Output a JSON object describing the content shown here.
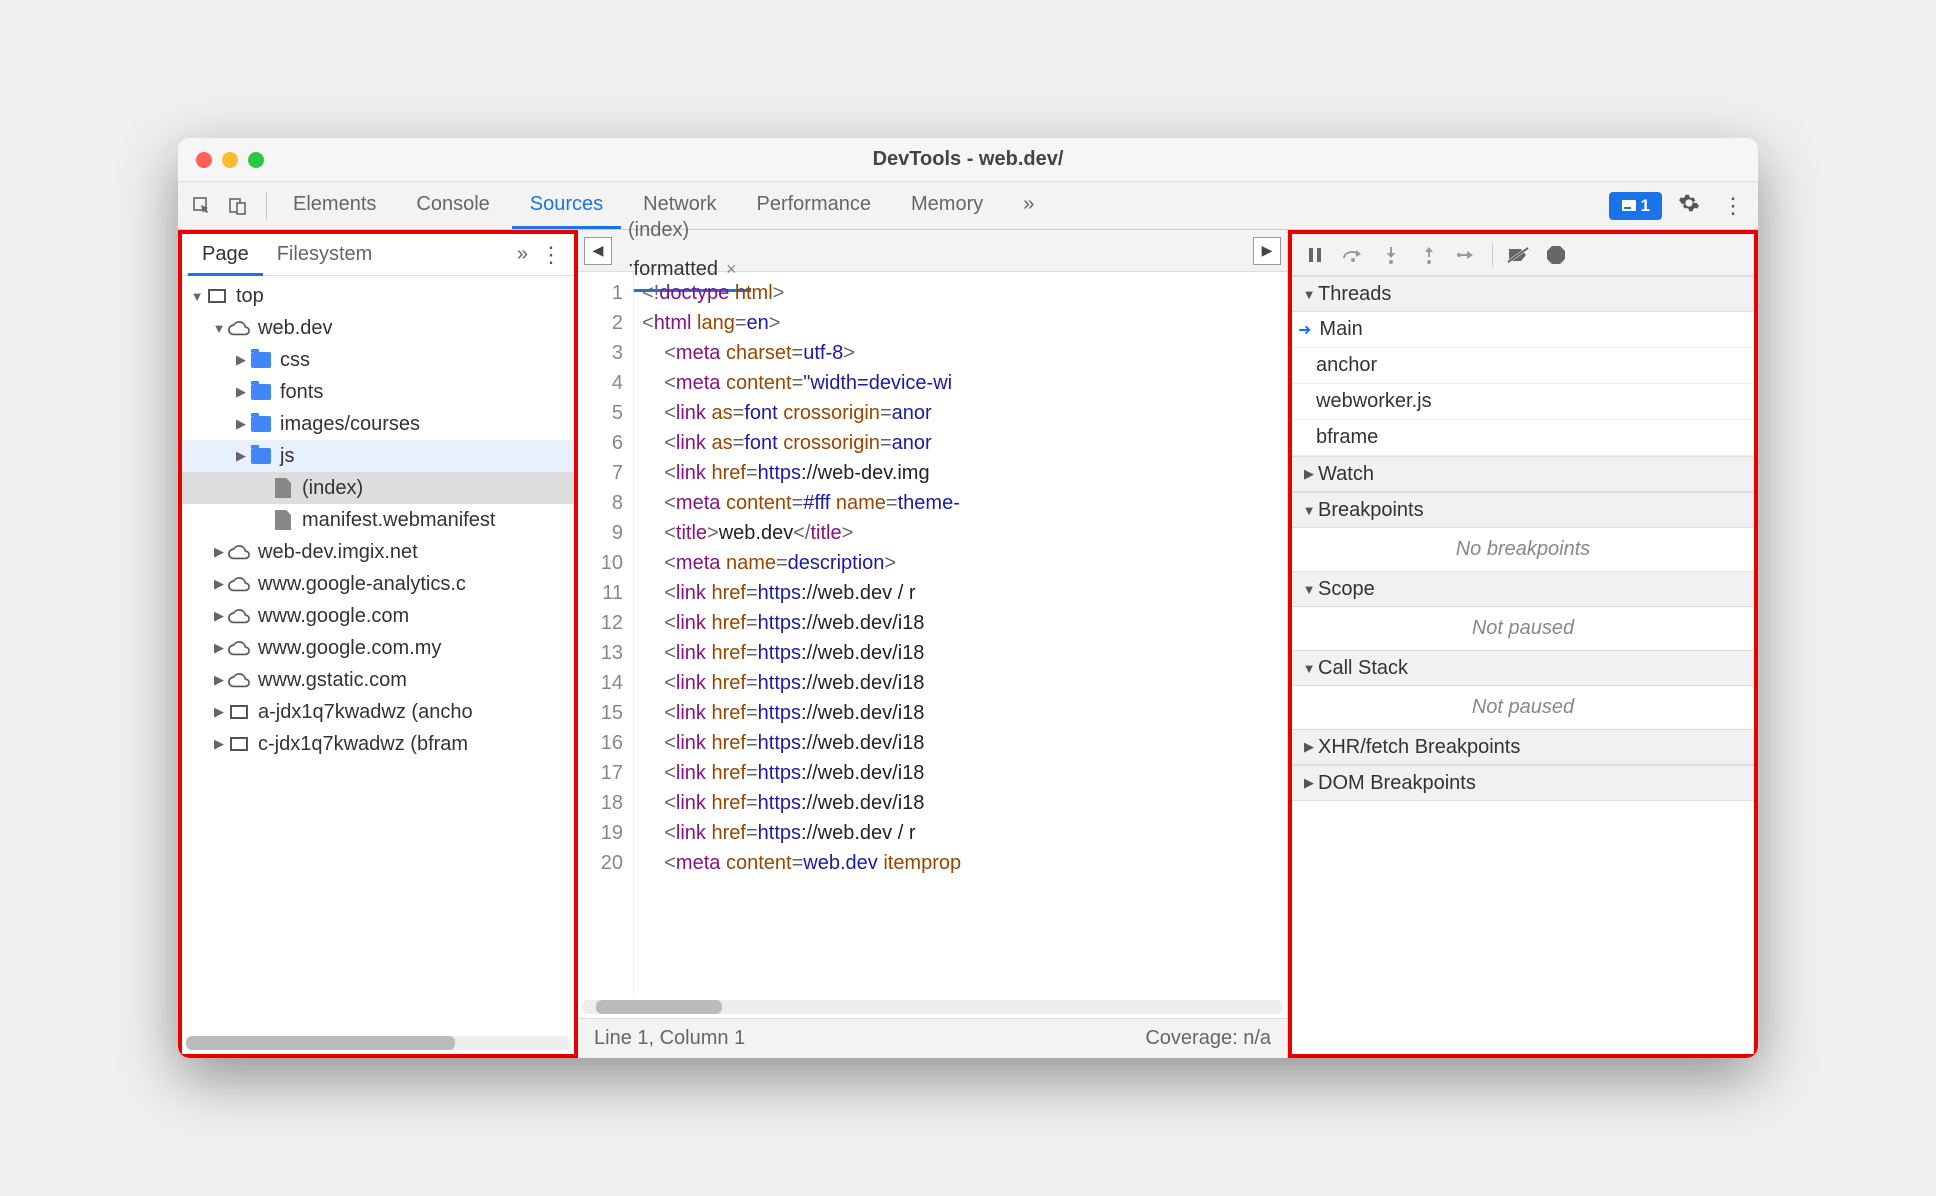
{
  "window": {
    "title": "DevTools - web.dev/"
  },
  "toolbar": {
    "tabs": [
      "Elements",
      "Console",
      "Sources",
      "Network",
      "Performance",
      "Memory"
    ],
    "active": "Sources",
    "overflow": "»",
    "badge_count": "1"
  },
  "navigator": {
    "tabs": [
      "Page",
      "Filesystem"
    ],
    "active": "Page",
    "overflow": "»",
    "tree": [
      {
        "depth": 0,
        "expand": "▼",
        "icon": "frame",
        "label": "top"
      },
      {
        "depth": 1,
        "expand": "▼",
        "icon": "cloud",
        "label": "web.dev"
      },
      {
        "depth": 2,
        "expand": "▶",
        "icon": "folder",
        "label": "css"
      },
      {
        "depth": 2,
        "expand": "▶",
        "icon": "folder",
        "label": "fonts"
      },
      {
        "depth": 2,
        "expand": "▶",
        "icon": "folder",
        "label": "images/courses"
      },
      {
        "depth": 2,
        "expand": "▶",
        "icon": "folder",
        "label": "js",
        "selected": true
      },
      {
        "depth": 3,
        "expand": "",
        "icon": "file",
        "label": "(index)",
        "highlighted": true
      },
      {
        "depth": 3,
        "expand": "",
        "icon": "file",
        "label": "manifest.webmanifest"
      },
      {
        "depth": 1,
        "expand": "▶",
        "icon": "cloud",
        "label": "web-dev.imgix.net"
      },
      {
        "depth": 1,
        "expand": "▶",
        "icon": "cloud",
        "label": "www.google-analytics.c"
      },
      {
        "depth": 1,
        "expand": "▶",
        "icon": "cloud",
        "label": "www.google.com"
      },
      {
        "depth": 1,
        "expand": "▶",
        "icon": "cloud",
        "label": "www.google.com.my"
      },
      {
        "depth": 1,
        "expand": "▶",
        "icon": "cloud",
        "label": "www.gstatic.com"
      },
      {
        "depth": 1,
        "expand": "▶",
        "icon": "frame",
        "label": "a-jdx1q7kwadwz (ancho"
      },
      {
        "depth": 1,
        "expand": "▶",
        "icon": "frame",
        "label": "c-jdx1q7kwadwz (bfram"
      }
    ]
  },
  "editor": {
    "tabs": [
      {
        "label": "(index)",
        "active": false,
        "closable": false
      },
      {
        "label": ":formatted",
        "active": true,
        "closable": true
      }
    ],
    "lines": [
      [
        [
          "punc",
          "<!"
        ],
        [
          "tag",
          "doctype"
        ],
        [
          "txt",
          " "
        ],
        [
          "attr",
          "html"
        ],
        [
          "punc",
          ">"
        ]
      ],
      [
        [
          "punc",
          "<"
        ],
        [
          "tag",
          "html"
        ],
        [
          "txt",
          " "
        ],
        [
          "attr",
          "lang"
        ],
        [
          "eq",
          "="
        ],
        [
          "val",
          "en"
        ],
        [
          "punc",
          ">"
        ]
      ],
      [
        [
          "txt",
          "    "
        ],
        [
          "punc",
          "<"
        ],
        [
          "tag",
          "meta"
        ],
        [
          "txt",
          " "
        ],
        [
          "attr",
          "charset"
        ],
        [
          "eq",
          "="
        ],
        [
          "val",
          "utf-8"
        ],
        [
          "punc",
          ">"
        ]
      ],
      [
        [
          "txt",
          "    "
        ],
        [
          "punc",
          "<"
        ],
        [
          "tag",
          "meta"
        ],
        [
          "txt",
          " "
        ],
        [
          "attr",
          "content"
        ],
        [
          "eq",
          "="
        ],
        [
          "val",
          "\"width=device-wi"
        ]
      ],
      [
        [
          "txt",
          "    "
        ],
        [
          "punc",
          "<"
        ],
        [
          "tag",
          "link"
        ],
        [
          "txt",
          " "
        ],
        [
          "attr",
          "as"
        ],
        [
          "eq",
          "="
        ],
        [
          "val",
          "font"
        ],
        [
          "txt",
          " "
        ],
        [
          "attr",
          "crossorigin"
        ],
        [
          "eq",
          "="
        ],
        [
          "val",
          "anor"
        ]
      ],
      [
        [
          "txt",
          "    "
        ],
        [
          "punc",
          "<"
        ],
        [
          "tag",
          "link"
        ],
        [
          "txt",
          " "
        ],
        [
          "attr",
          "as"
        ],
        [
          "eq",
          "="
        ],
        [
          "val",
          "font"
        ],
        [
          "txt",
          " "
        ],
        [
          "attr",
          "crossorigin"
        ],
        [
          "eq",
          "="
        ],
        [
          "val",
          "anor"
        ]
      ],
      [
        [
          "txt",
          "    "
        ],
        [
          "punc",
          "<"
        ],
        [
          "tag",
          "link"
        ],
        [
          "txt",
          " "
        ],
        [
          "attr",
          "href"
        ],
        [
          "eq",
          "="
        ],
        [
          "val",
          "https"
        ],
        [
          "txt",
          "://web-dev.img"
        ]
      ],
      [
        [
          "txt",
          "    "
        ],
        [
          "punc",
          "<"
        ],
        [
          "tag",
          "meta"
        ],
        [
          "txt",
          " "
        ],
        [
          "attr",
          "content"
        ],
        [
          "eq",
          "="
        ],
        [
          "val",
          "#fff"
        ],
        [
          "txt",
          " "
        ],
        [
          "attr",
          "name"
        ],
        [
          "eq",
          "="
        ],
        [
          "val",
          "theme-"
        ]
      ],
      [
        [
          "txt",
          "    "
        ],
        [
          "punc",
          "<"
        ],
        [
          "tag",
          "title"
        ],
        [
          "punc",
          ">"
        ],
        [
          "txt",
          "web.dev"
        ],
        [
          "punc",
          "</"
        ],
        [
          "tag",
          "title"
        ],
        [
          "punc",
          ">"
        ]
      ],
      [
        [
          "txt",
          "    "
        ],
        [
          "punc",
          "<"
        ],
        [
          "tag",
          "meta"
        ],
        [
          "txt",
          " "
        ],
        [
          "attr",
          "name"
        ],
        [
          "eq",
          "="
        ],
        [
          "val",
          "description"
        ],
        [
          "punc",
          ">"
        ]
      ],
      [
        [
          "txt",
          "    "
        ],
        [
          "punc",
          "<"
        ],
        [
          "tag",
          "link"
        ],
        [
          "txt",
          " "
        ],
        [
          "attr",
          "href"
        ],
        [
          "eq",
          "="
        ],
        [
          "val",
          "https"
        ],
        [
          "txt",
          "://web.dev / r"
        ]
      ],
      [
        [
          "txt",
          "    "
        ],
        [
          "punc",
          "<"
        ],
        [
          "tag",
          "link"
        ],
        [
          "txt",
          " "
        ],
        [
          "attr",
          "href"
        ],
        [
          "eq",
          "="
        ],
        [
          "val",
          "https"
        ],
        [
          "txt",
          "://web.dev/i18"
        ]
      ],
      [
        [
          "txt",
          "    "
        ],
        [
          "punc",
          "<"
        ],
        [
          "tag",
          "link"
        ],
        [
          "txt",
          " "
        ],
        [
          "attr",
          "href"
        ],
        [
          "eq",
          "="
        ],
        [
          "val",
          "https"
        ],
        [
          "txt",
          "://web.dev/i18"
        ]
      ],
      [
        [
          "txt",
          "    "
        ],
        [
          "punc",
          "<"
        ],
        [
          "tag",
          "link"
        ],
        [
          "txt",
          " "
        ],
        [
          "attr",
          "href"
        ],
        [
          "eq",
          "="
        ],
        [
          "val",
          "https"
        ],
        [
          "txt",
          "://web.dev/i18"
        ]
      ],
      [
        [
          "txt",
          "    "
        ],
        [
          "punc",
          "<"
        ],
        [
          "tag",
          "link"
        ],
        [
          "txt",
          " "
        ],
        [
          "attr",
          "href"
        ],
        [
          "eq",
          "="
        ],
        [
          "val",
          "https"
        ],
        [
          "txt",
          "://web.dev/i18"
        ]
      ],
      [
        [
          "txt",
          "    "
        ],
        [
          "punc",
          "<"
        ],
        [
          "tag",
          "link"
        ],
        [
          "txt",
          " "
        ],
        [
          "attr",
          "href"
        ],
        [
          "eq",
          "="
        ],
        [
          "val",
          "https"
        ],
        [
          "txt",
          "://web.dev/i18"
        ]
      ],
      [
        [
          "txt",
          "    "
        ],
        [
          "punc",
          "<"
        ],
        [
          "tag",
          "link"
        ],
        [
          "txt",
          " "
        ],
        [
          "attr",
          "href"
        ],
        [
          "eq",
          "="
        ],
        [
          "val",
          "https"
        ],
        [
          "txt",
          "://web.dev/i18"
        ]
      ],
      [
        [
          "txt",
          "    "
        ],
        [
          "punc",
          "<"
        ],
        [
          "tag",
          "link"
        ],
        [
          "txt",
          " "
        ],
        [
          "attr",
          "href"
        ],
        [
          "eq",
          "="
        ],
        [
          "val",
          "https"
        ],
        [
          "txt",
          "://web.dev/i18"
        ]
      ],
      [
        [
          "txt",
          "    "
        ],
        [
          "punc",
          "<"
        ],
        [
          "tag",
          "link"
        ],
        [
          "txt",
          " "
        ],
        [
          "attr",
          "href"
        ],
        [
          "eq",
          "="
        ],
        [
          "val",
          "https"
        ],
        [
          "txt",
          "://web.dev / r"
        ]
      ],
      [
        [
          "txt",
          "    "
        ],
        [
          "punc",
          "<"
        ],
        [
          "tag",
          "meta"
        ],
        [
          "txt",
          " "
        ],
        [
          "attr",
          "content"
        ],
        [
          "eq",
          "="
        ],
        [
          "val",
          "web.dev"
        ],
        [
          "txt",
          " "
        ],
        [
          "attr",
          "itemprop"
        ]
      ]
    ],
    "status_left": "Line 1, Column 1",
    "status_right": "Coverage: n/a"
  },
  "debugger": {
    "sections": [
      {
        "title": "Threads",
        "expanded": true,
        "items": [
          {
            "label": "Main",
            "active": true
          },
          {
            "label": "anchor"
          },
          {
            "label": "webworker.js"
          },
          {
            "label": "bframe"
          }
        ]
      },
      {
        "title": "Watch",
        "expanded": false
      },
      {
        "title": "Breakpoints",
        "expanded": true,
        "empty": "No breakpoints"
      },
      {
        "title": "Scope",
        "expanded": true,
        "empty": "Not paused"
      },
      {
        "title": "Call Stack",
        "expanded": true,
        "empty": "Not paused"
      },
      {
        "title": "XHR/fetch Breakpoints",
        "expanded": false
      },
      {
        "title": "DOM Breakpoints",
        "expanded": false
      }
    ]
  }
}
